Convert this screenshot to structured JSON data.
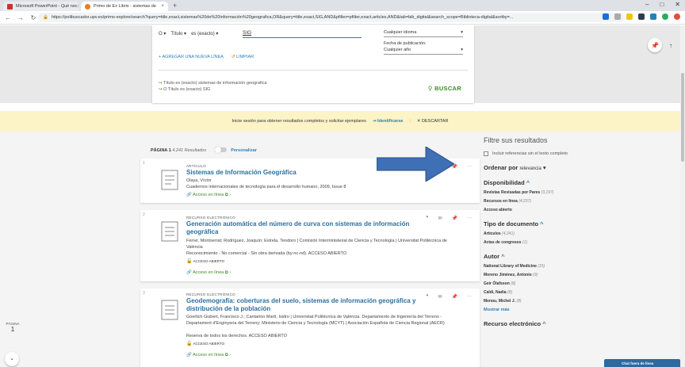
{
  "browser": {
    "tab1": "Microsoft PowerPoint - Qué nec:",
    "tab2": "Primo de Ex Libris - sistemas de",
    "url": "https://polibuscador.upv.es/primo-explore/search?query=title,exact,sistemas%20de%20información%20geografica,OR&query=title,exact,SIG,AND&pfilter=pfilter,exact,articles,AND&tab=bib_digital&search_scope=Biblioteca-digital&sortby=..."
  },
  "search": {
    "operator": "O",
    "field": "Título",
    "precision": "es (exacto)",
    "term": "SIG",
    "language": "Cualquier idioma",
    "pub_date_label": "Fecha de publicación:",
    "pub_date_value": "Cualquier año",
    "add_line": "AGREGAR UNA NUEVA LÍNEA",
    "clear": "LIMPIAR",
    "query_line1": "Título es (exacto) sistemas de información geografica",
    "query_line2": "O Título es (exacto) SIG",
    "search_button": "BUSCAR"
  },
  "banner": {
    "text": "Inicie sesión para obtener resultados completos y solicitar ejemplares",
    "identify": "Identificarse",
    "dismiss": "DESCARTAR"
  },
  "results_header": {
    "page_label": "PÁGINA 1",
    "count": "4.241 Resultados",
    "personalize": "Personalizar"
  },
  "results": [
    {
      "num": "1",
      "type": "ARTÍCULO",
      "title": "Sistemas de Información Geográfica",
      "lines": [
        "Olaya, Víctor",
        "Cuadernos internacionales de tecnología para el desarrollo humano, 2009, Issue 8"
      ],
      "open_access": "",
      "access": "Acceso en línea"
    },
    {
      "num": "2",
      "type": "RECURSO ELECTRÓNICO",
      "title": "Generación automática del número de curva con sistemas de información geográfica",
      "lines": [
        "Ferrer, Montserrat; Rodríguez, Joaquín; Estrela, Teodoro | Comisión Interministerial de Ciencia y Tecnología | Universitat Politècnica de València",
        "Reconocimiento - No comercial - Sin obra derivada (by-nc-nd). ACCESO ABIERTO"
      ],
      "open_access": "ACCESO ABIERTO",
      "access": "Acceso en línea"
    },
    {
      "num": "3",
      "type": "RECURSO ELECTRÓNICO",
      "title": "Geodemografía: coberturas del suelo, sistemas de información geográfica y distribución de la población",
      "lines": [
        "Goerlich Gisbert, Francisco J.; Cantarino Martí, Isidro | Universitat Politècnica de València. Departamento de Ingeniería del Terreno - Departament d'Enginyeria del Terreny; Ministerio de Ciencia y Tecnología (MCYT) | Asociación Española de Ciencia Regional (AECR)",
        "Reserva de todos los derechos. ACCESO ABIERTO"
      ],
      "open_access": "ACCESO ABIERTO",
      "access": "Acceso en línea"
    }
  ],
  "filters": {
    "heading": "Filtre sus resultados",
    "exclude": "Incluir referencias sin el texto completo",
    "sort_label": "Ordenar por",
    "sort_value": "relevancia",
    "availability": "Disponibilidad",
    "avail_items": [
      {
        "label": "Revistas Revisadas por Pares",
        "count": "(3,197)"
      },
      {
        "label": "Recursos en línea",
        "count": "(4,237)"
      },
      {
        "label": "Acceso abierto",
        "count": ""
      }
    ],
    "doc_type": "Tipo de documento",
    "doc_items": [
      {
        "label": "Artículos",
        "count": "(4,241)"
      },
      {
        "label": "Actas de congresos",
        "count": "(1)"
      }
    ],
    "author": "Autor",
    "author_items": [
      {
        "label": "National Library of Medicine",
        "count": "(15)"
      },
      {
        "label": "Moreno Jiménez, Antonio",
        "count": "(9)"
      },
      {
        "label": "Geir Ólafsson",
        "count": "(8)"
      },
      {
        "label": "Caldi, Nadia",
        "count": "(8)"
      },
      {
        "label": "Menou, Michel J.",
        "count": "(8)"
      }
    ],
    "show_more": "Mostrar más",
    "electronic": "Recurso electrónico"
  },
  "pager": {
    "label": "PÁGINA",
    "value": "1"
  },
  "chat": "Chat fuera de línea"
}
